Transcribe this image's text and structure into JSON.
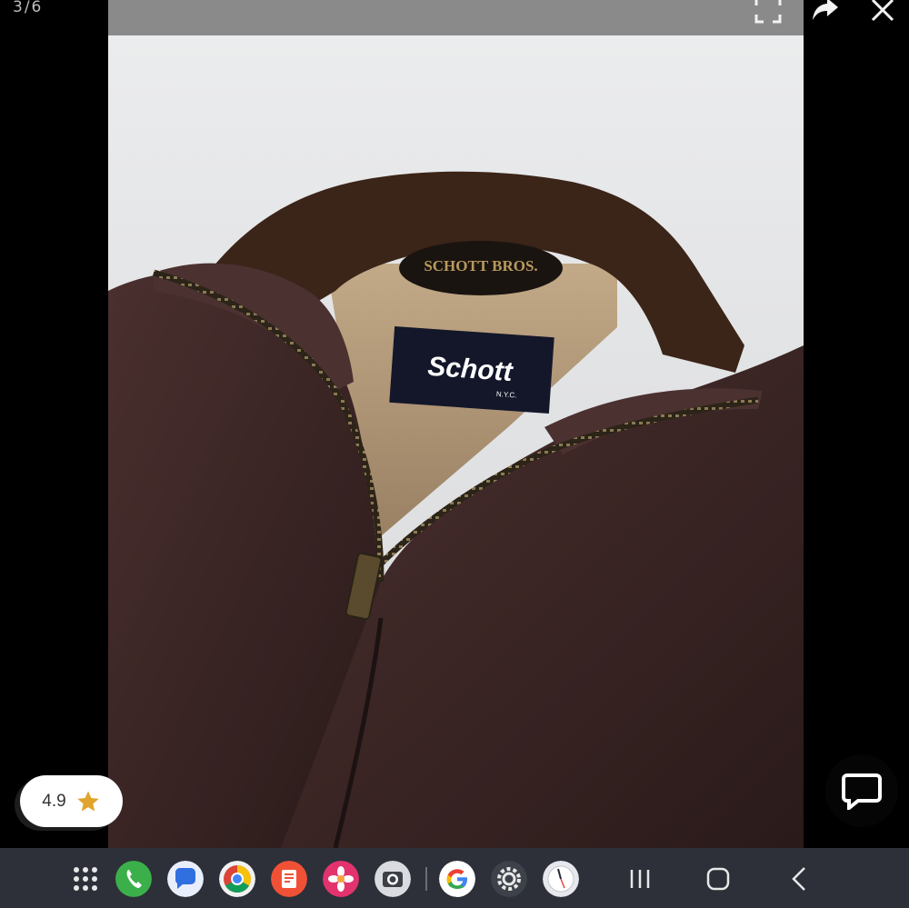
{
  "viewer": {
    "counter": "3/6",
    "photo_alt": "Schott brown leather jacket with Schott N.Y.C. label",
    "label_brand": "Schott",
    "label_sub": "N.Y.C.",
    "collar_patch": "SCHOTT BROS."
  },
  "rating": {
    "value": "4.9",
    "star_color": "#e1a42c"
  },
  "taskbar": {
    "apps": [
      "app-drawer",
      "phone",
      "messages",
      "chrome",
      "samsung-notes",
      "gallery",
      "camera",
      "google",
      "settings",
      "clock"
    ]
  },
  "colors": {
    "taskbar_bg": "#2d3038",
    "leather": "#3a2524",
    "collar": "#3b2418",
    "lining": "#b39b7c"
  }
}
